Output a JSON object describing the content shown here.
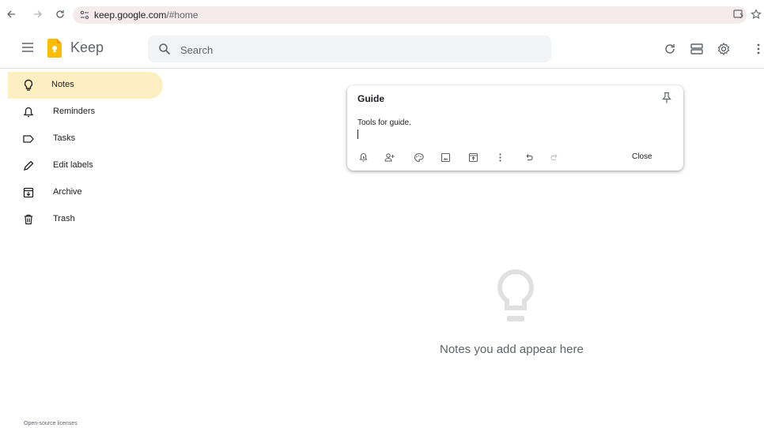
{
  "browser": {
    "url_domain": "keep.google.com",
    "url_path": "/#home"
  },
  "header": {
    "brand": "Keep",
    "search_placeholder": "Search",
    "search_value": ""
  },
  "sidebar": {
    "items": [
      {
        "label": "Notes",
        "icon": "lightbulb-icon",
        "active": true
      },
      {
        "label": "Reminders",
        "icon": "bell-icon",
        "active": false
      },
      {
        "label": "Tasks",
        "icon": "label-tag-icon",
        "active": false
      },
      {
        "label": "Edit labels",
        "icon": "pencil-icon",
        "active": false
      },
      {
        "label": "Archive",
        "icon": "archive-icon",
        "active": false
      },
      {
        "label": "Trash",
        "icon": "trash-icon",
        "active": false
      }
    ]
  },
  "note": {
    "title": "Guide",
    "body": "Tools for guide.",
    "close_label": "Close"
  },
  "empty_state": {
    "text": "Notes you add appear here"
  },
  "footer": {
    "text": "Open-source licenses"
  },
  "colors": {
    "active_item": "#feefc3",
    "logo": "#fbbc04",
    "address_bar": "#f5eaec"
  }
}
